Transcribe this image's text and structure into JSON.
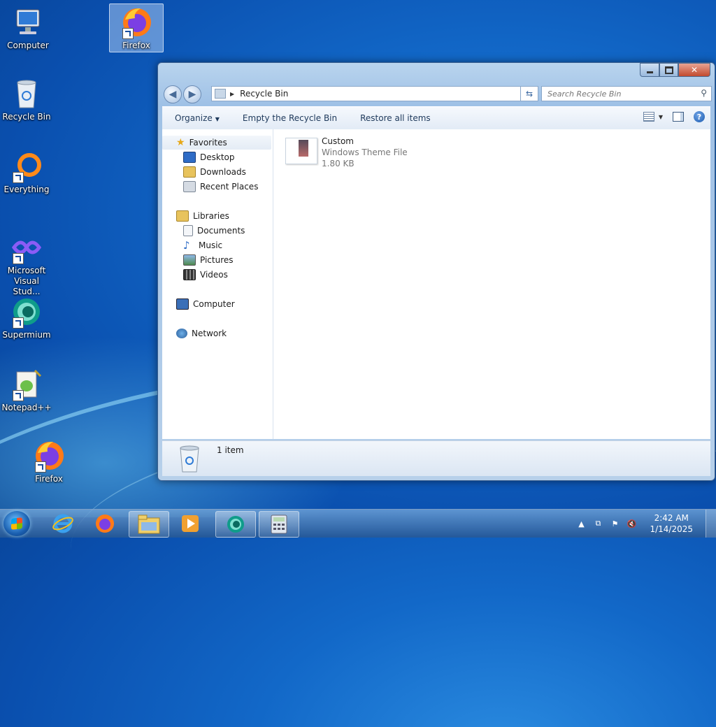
{
  "desktop": {
    "icons": [
      {
        "label": "Computer"
      },
      {
        "label": "Firefox"
      },
      {
        "label": "Recycle Bin"
      },
      {
        "label": "Everything"
      },
      {
        "label": "Microsoft Visual Stud..."
      },
      {
        "label": "Supermium"
      },
      {
        "label": "Notepad++"
      },
      {
        "label": "Firefox"
      }
    ]
  },
  "window": {
    "title": "Recycle Bin",
    "address": {
      "crumb": "Recycle Bin"
    },
    "search": {
      "placeholder": "Search Recycle Bin"
    },
    "toolbar": {
      "organize": "Organize",
      "empty": "Empty the Recycle Bin",
      "restore": "Restore all items"
    },
    "nav": {
      "favorites": "Favorites",
      "desktop": "Desktop",
      "downloads": "Downloads",
      "recent": "Recent Places",
      "libraries": "Libraries",
      "documents": "Documents",
      "music": "Music",
      "pictures": "Pictures",
      "videos": "Videos",
      "computer": "Computer",
      "network": "Network"
    },
    "items": [
      {
        "name": "Custom",
        "type": "Windows Theme File",
        "size": "1.80 KB"
      }
    ],
    "details": {
      "count": "1 item"
    },
    "buttons": {
      "close": "✕"
    }
  },
  "taskbar": {
    "time": "2:42 AM",
    "date": "1/14/2025"
  },
  "colors": {
    "desktop_bg": "#1268c8",
    "window_frame": "#a9c8e8",
    "close_button": "#c24a2f"
  }
}
